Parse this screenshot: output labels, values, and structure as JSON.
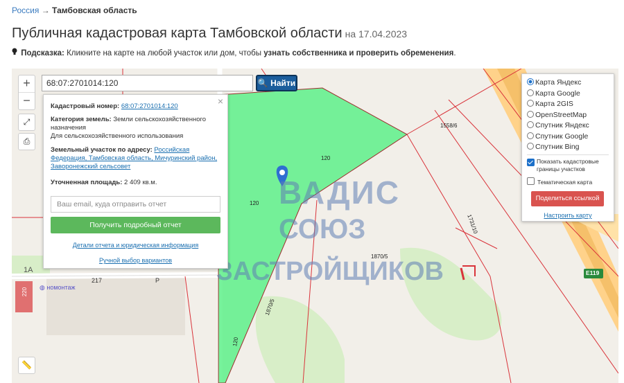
{
  "breadcrumb": {
    "root": "Россия",
    "arrow": "→",
    "current": "Тамбовская область"
  },
  "page": {
    "title": "Публичная кадастровая карта Тамбовской области",
    "date": "на 17.04.2023"
  },
  "hint": {
    "label": "Подсказка:",
    "text": " Кликните на карте на любой участок или дом, чтобы ",
    "bold": "узнать собственника и проверить обременения",
    "end": "."
  },
  "search": {
    "value": "68:07:2701014:120",
    "button": "Найти"
  },
  "zoom": {
    "in": "+",
    "out": "−"
  },
  "panel": {
    "close": "×",
    "cad_label": "Кадастровый номер: ",
    "cad_value": "68:07:2701014:120",
    "cat_label": "Категория земель: ",
    "cat_value": "Земли сельскохозяйственного назначения",
    "use_value": "Для сельскохозяйственного использования",
    "addr_label": "Земельный участок по адресу: ",
    "addr_value": "Российская Федерация, Тамбовская область, Мичуринский район, Заворонежский сельсовет",
    "area_label": "Уточненная площадь: ",
    "area_value": "2 409 кв.м.",
    "email_placeholder": "Ваш email, куда отправить отчет",
    "get_button": "Получить подробный отчет",
    "details_link": "Детали отчета и юридическая информация",
    "manual_link": "Ручной выбор вариантов"
  },
  "layers": {
    "options": [
      {
        "label": "Карта Яндекс",
        "selected": true
      },
      {
        "label": "Карта Google",
        "selected": false
      },
      {
        "label": "Карта 2GIS",
        "selected": false
      },
      {
        "label": "OpenStreetMap",
        "selected": false
      },
      {
        "label": "Спутник Яндекс",
        "selected": false
      },
      {
        "label": "Спутник Google",
        "selected": false
      },
      {
        "label": "Спутник Bing",
        "selected": false
      }
    ],
    "show_borders": "Показать кадастровые границы участков",
    "thematic": "Тематическая карта",
    "share_button": "Поделиться ссылкой",
    "setup_link": "Настроить карту"
  },
  "map_labels": {
    "plot_120_a": "120",
    "plot_120_b": "120",
    "plot_120_c": "120",
    "num_1558": "1558/6",
    "num_1731": "1731/10",
    "num_1870_5": "1870/5",
    "num_1870_5b": "1870/5",
    "road_217": "217",
    "road_p": "Р",
    "road_e119": "E119",
    "bldg_1a": "1А",
    "bldg_220": "220",
    "poi": "номонтаж"
  },
  "watermark": {
    "line1": "ВАДИС",
    "line2": "СОЮЗ",
    "line3": "ЗАСТРОЙЩИКОВ"
  },
  "colors": {
    "accent": "#1b5d9c",
    "plot_fill": "#5ef08a",
    "get_button": "#5cb85c",
    "share_button": "#d9534f"
  }
}
